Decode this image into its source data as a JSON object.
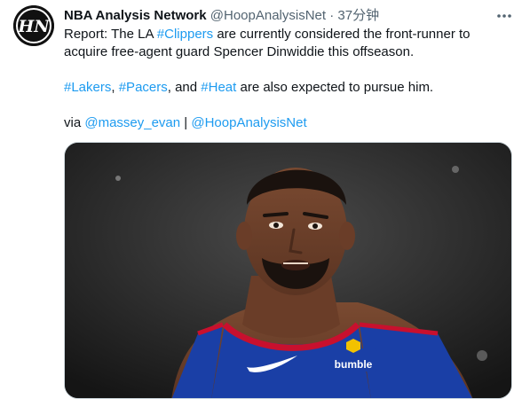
{
  "account": {
    "display_name": "NBA Analysis Network",
    "handle": "@HoopAnalysisNet",
    "separator": "·",
    "time": "37分钟",
    "avatar_letters": "HN"
  },
  "tweet": {
    "line1_prefix": "Report: The LA ",
    "line1_tag": "#Clippers",
    "line1_suffix": " are currently considered the front-runner to acquire free-agent guard Spencer Dinwiddie this offseason.",
    "p2_tag1": "#Lakers",
    "p2_sep1": ", ",
    "p2_tag2": "#Pacers",
    "p2_sep2": ", and ",
    "p2_tag3": "#Heat",
    "p2_suffix": " are also expected to pursue him.",
    "p3_prefix": "via ",
    "p3_mention1": "@massey_evan",
    "p3_sep": " | ",
    "p3_mention2": "@HoopAnalysisNet"
  },
  "media": {
    "jersey_sponsor": "bumble"
  },
  "colors": {
    "link": "#1d9bf0",
    "text": "#0f1419",
    "muted": "#536471",
    "jersey_blue": "#1a3fa6",
    "jersey_red": "#c8102e"
  },
  "icons": {
    "more": "more-horizontal-icon"
  }
}
